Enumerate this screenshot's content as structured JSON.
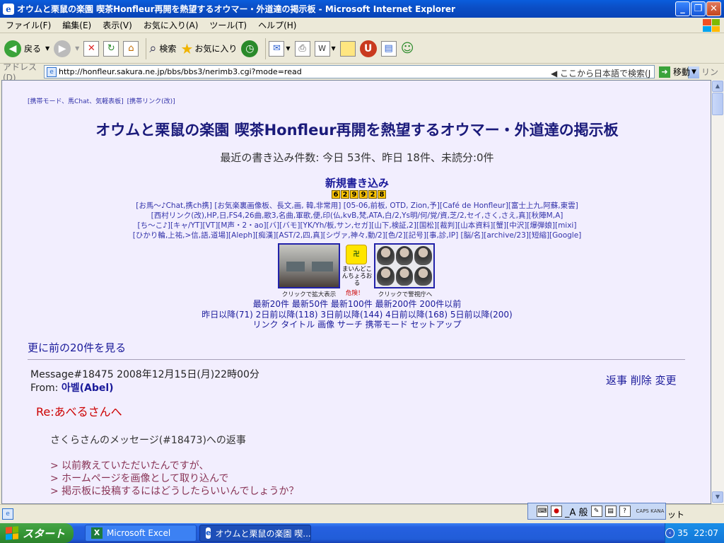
{
  "window": {
    "title": "オウムと栗鼠の楽園 喫茶Honfleur再開を熱望するオウマー・外道達の掲示板 - Microsoft Internet Explorer",
    "min": "_",
    "max": "❐",
    "close": "✕"
  },
  "menu": [
    "ファイル(F)",
    "編集(E)",
    "表示(V)",
    "お気に入り(A)",
    "ツール(T)",
    "ヘルプ(H)"
  ],
  "toolbar": {
    "back": "戻る",
    "search": "検索",
    "favorites": "お気に入り"
  },
  "address": {
    "label": "アドレス(D)",
    "url": "http://honfleur.sakura.ne.jp/bbs/bbs3/nerimb3.cgi?mode=read",
    "jword": "◀ ここから日本語で検索(J Word)",
    "go": "移動",
    "links": "リンク"
  },
  "page": {
    "nav": [
      "[携帯モード、馬Chat、気軽表板]",
      "[携帯リンク(改)]"
    ],
    "title": "オウムと栗鼠の楽園 喫茶Honfleur再開を熱望するオウマー・外道達の掲示板",
    "counts": "最近の書き込み件数: 今日 53件、昨日 18件、未読分:0件",
    "new_post": "新規書き込み",
    "counter_digits": [
      "6",
      "2",
      "9",
      "9",
      "2",
      "8"
    ],
    "link_rows": [
      "[お馬～♪Chat,携ch携] [お気楽裏画像板、長文,画, 韓,非常用] [05-06,前板, OTD, Zion,予][Café de Honfleur][富士上九,阿蘇,東雲]",
      "[西村リンク(改),HP,日,FS4,26曲,歌3,名曲,軍歌,便,印(仏,kvB,梵,ATA,白/2,Ys明/何/覚/資,芝/2,セイ,さく,さえ,真][秋陣M,A]",
      "[ち～こ♪][キャ/YT][VT][M声・2・ao][バ][バモ][YK/Yh/板,サン,セガ][山下,検証,2][国松][裁判][山本資料][蟹][中沢][爆弾娘][mixi]",
      "[ひかり輪,上祐,>信,語,道場][Aleph][痴漢][AST/2,四,真][シヴァ,神々,動/2][色/2][記号][事,診,IP] [脳/名][archive/23][短縮][Google]"
    ],
    "photo_caption_left": "クリックで拡大表示",
    "photo_caption_right": "クリックで警視庁へ",
    "badge_text": "まいんどこんちょろおる",
    "badge_danger": "危険！",
    "latest": "最新20件 最新50件 最新100件 最新200件 200件以前",
    "since": "昨日以降(71) 2日前以降(118) 3日前以降(144) 4日前以降(168) 5日前以降(200)",
    "menu2": "リンク タイトル 画像 サーチ 携帯モード セットアップ",
    "prev20": "更に前の20件を見る"
  },
  "message": {
    "header": "Message#18475 2008年12月15日(月)22時00分",
    "from_label": "From:",
    "author": "아벨(Abel)",
    "actions": "返事 削除 変更",
    "subject": "Re:あべるさんへ",
    "reply_to": "さくらさんのメッセージ(#18473)への返事",
    "quotes": [
      "> 以前教えていただいたんですが、",
      "> ホームページを画像として取り込んで",
      "> 掲示板に投稿するにはどうしたらいいんでしょうか？"
    ]
  },
  "status": {
    "ime_text": "_A 般",
    "caps_kana": "CAPS KANA",
    "suffix": "ット"
  },
  "taskbar": {
    "start": "スタート",
    "tasks": [
      "Microsoft Excel",
      "オウムと栗鼠の楽園 喫..."
    ],
    "tray_left": "35",
    "clock": "22:07"
  },
  "colors": {
    "content_bg": "#f2eefe",
    "link": "#1a1a9a",
    "subject": "#cc0000",
    "taskbar": "#245edb",
    "start": "#359635"
  }
}
